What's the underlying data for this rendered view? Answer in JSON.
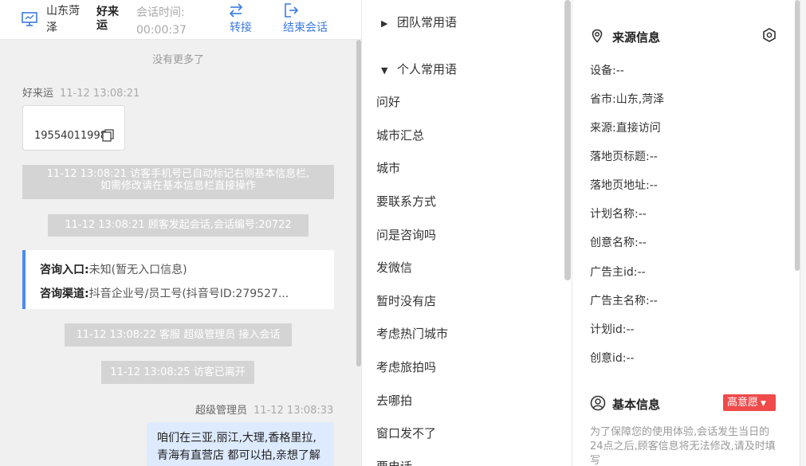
{
  "header": {
    "location": "山东菏泽",
    "visitor_name": "好来运",
    "session_time_label": "会话时间:",
    "session_time_value": "00:00:37",
    "transfer_label": "转接",
    "end_label": "结束会话"
  },
  "chat": {
    "no_more": "没有更多了",
    "visitor_msg": {
      "sender": "好来运",
      "time": "11-12 13:08:21",
      "content": "19554011998"
    },
    "sys1_line1": "11-12 13:08:21 访客手机号已自动标记右侧基本信息栏,",
    "sys1_line2": "如需修改请在基本信息栏直接操作",
    "sys2": "11-12 13:08:21 顾客发起会话,会话编号:20722",
    "info_card": {
      "entry_label": "咨询入口:",
      "entry_value": "未知(暂无入口信息)",
      "channel_label": "咨询渠道:",
      "channel_value": "抖音企业号/员工号(抖音号ID:279527..."
    },
    "sys3": "11-12 13:08:22 客服 超级管理员 接入会话",
    "sys4": "11-12 13:08:25 访客已离开",
    "agent_msg": {
      "sender": "超级管理员",
      "time": "11-12 13:08:33",
      "content": "咱们在三亚,丽江,大理,香格里拉,青海有直营店 都可以拍,亲想了解哪个城市的呢?还是不"
    }
  },
  "phrases": {
    "team_group": "团队常用语",
    "personal_group": "个人常用语",
    "items": [
      "问好",
      "城市汇总",
      "城市",
      "要联系方式",
      "问是咨询吗",
      "发微信",
      "暂时没有店",
      "考虑热门城市",
      "考虑旅拍吗",
      "去哪拍",
      "窗口发不了",
      "要电话"
    ]
  },
  "info": {
    "source_title": "来源信息",
    "fields": [
      {
        "label": "设备:",
        "value": "--"
      },
      {
        "label": "省市:",
        "value": "山东,菏泽"
      },
      {
        "label": "来源:",
        "value": "直接访问"
      },
      {
        "label": "落地页标题:",
        "value": "--"
      },
      {
        "label": "落地页地址:",
        "value": "--"
      },
      {
        "label": "计划名称:",
        "value": "--"
      },
      {
        "label": "创意名称:",
        "value": "--"
      },
      {
        "label": "广告主id:",
        "value": "--"
      },
      {
        "label": "广告主名称:",
        "value": "--"
      },
      {
        "label": "计划id:",
        "value": "--"
      },
      {
        "label": "创意id:",
        "value": "--"
      }
    ],
    "basic_title": "基本信息",
    "intent_badge": "高意愿",
    "notice": "为了保障您的使用体验,会话发生当日的24点之后,顾客信息将无法修改,请及时填写"
  },
  "colors": {
    "accent": "#3c7be0",
    "badge": "#f04a4a",
    "card_border": "#4a8af4",
    "agent_bubble": "#ddeaff"
  }
}
